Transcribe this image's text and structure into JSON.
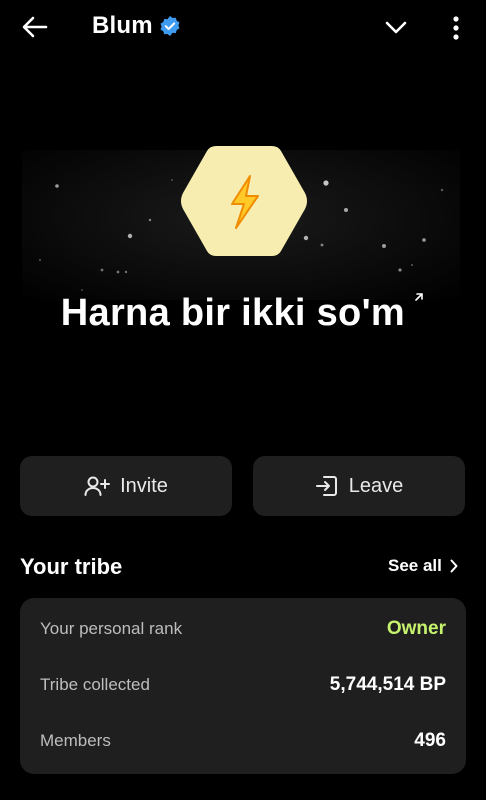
{
  "header": {
    "title": "Blum",
    "verified_icon": "verified-badge-icon",
    "back_icon": "arrow-left-icon",
    "dropdown_icon": "chevron-down-icon",
    "more_icon": "more-vertical-icon"
  },
  "tribe": {
    "name": "Harna bir ikki so'm",
    "external_icon": "arrow-up-right-icon",
    "logo_icon": "lightning-hexagon-icon",
    "logo_color": "#f7edb0"
  },
  "actions": {
    "invite_label": "Invite",
    "leave_label": "Leave"
  },
  "your_tribe": {
    "title": "Your tribe",
    "see_all_label": "See all",
    "rows": [
      {
        "label": "Your personal rank",
        "value": "Owner"
      },
      {
        "label": "Tribe collected",
        "value": "5,744,514 BP"
      },
      {
        "label": "Members",
        "value": "496"
      }
    ]
  },
  "colors": {
    "background": "#000000",
    "card": "#1f1f1f",
    "accent_green": "#c6f36d",
    "verified_blue": "#3f9bf0"
  }
}
